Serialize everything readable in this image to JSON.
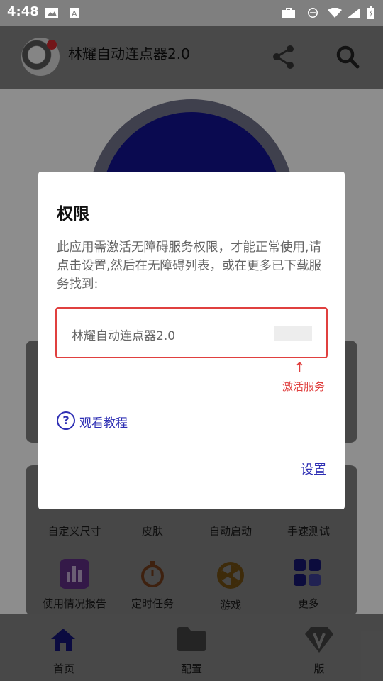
{
  "status_bar": {
    "time": "4:48"
  },
  "header": {
    "app_title": "林耀自动连点器2.0"
  },
  "grid": {
    "row1": [
      "自定义尺寸",
      "皮肤",
      "自动启动",
      "手速测试"
    ],
    "row2": [
      "使用情况报告",
      "定时任务",
      "游戏",
      "更多"
    ]
  },
  "bottom_nav": {
    "home": "首页",
    "config": "配置",
    "version": "版"
  },
  "dialog": {
    "title": "权限",
    "message": "此应用需激活无障碍服务权限，才能正常使用,请点击设置,然后在无障碍列表，或在更多已下载服务找到:",
    "service_name": "林耀自动连点器2.0",
    "arrow": "↑",
    "activate_hint": "激活服务",
    "tutorial_link": "观看教程",
    "settings_button": "设置"
  },
  "colors": {
    "accent": "#2e2fb4",
    "warning": "#e0403f",
    "primary_circle": "#12128a"
  }
}
